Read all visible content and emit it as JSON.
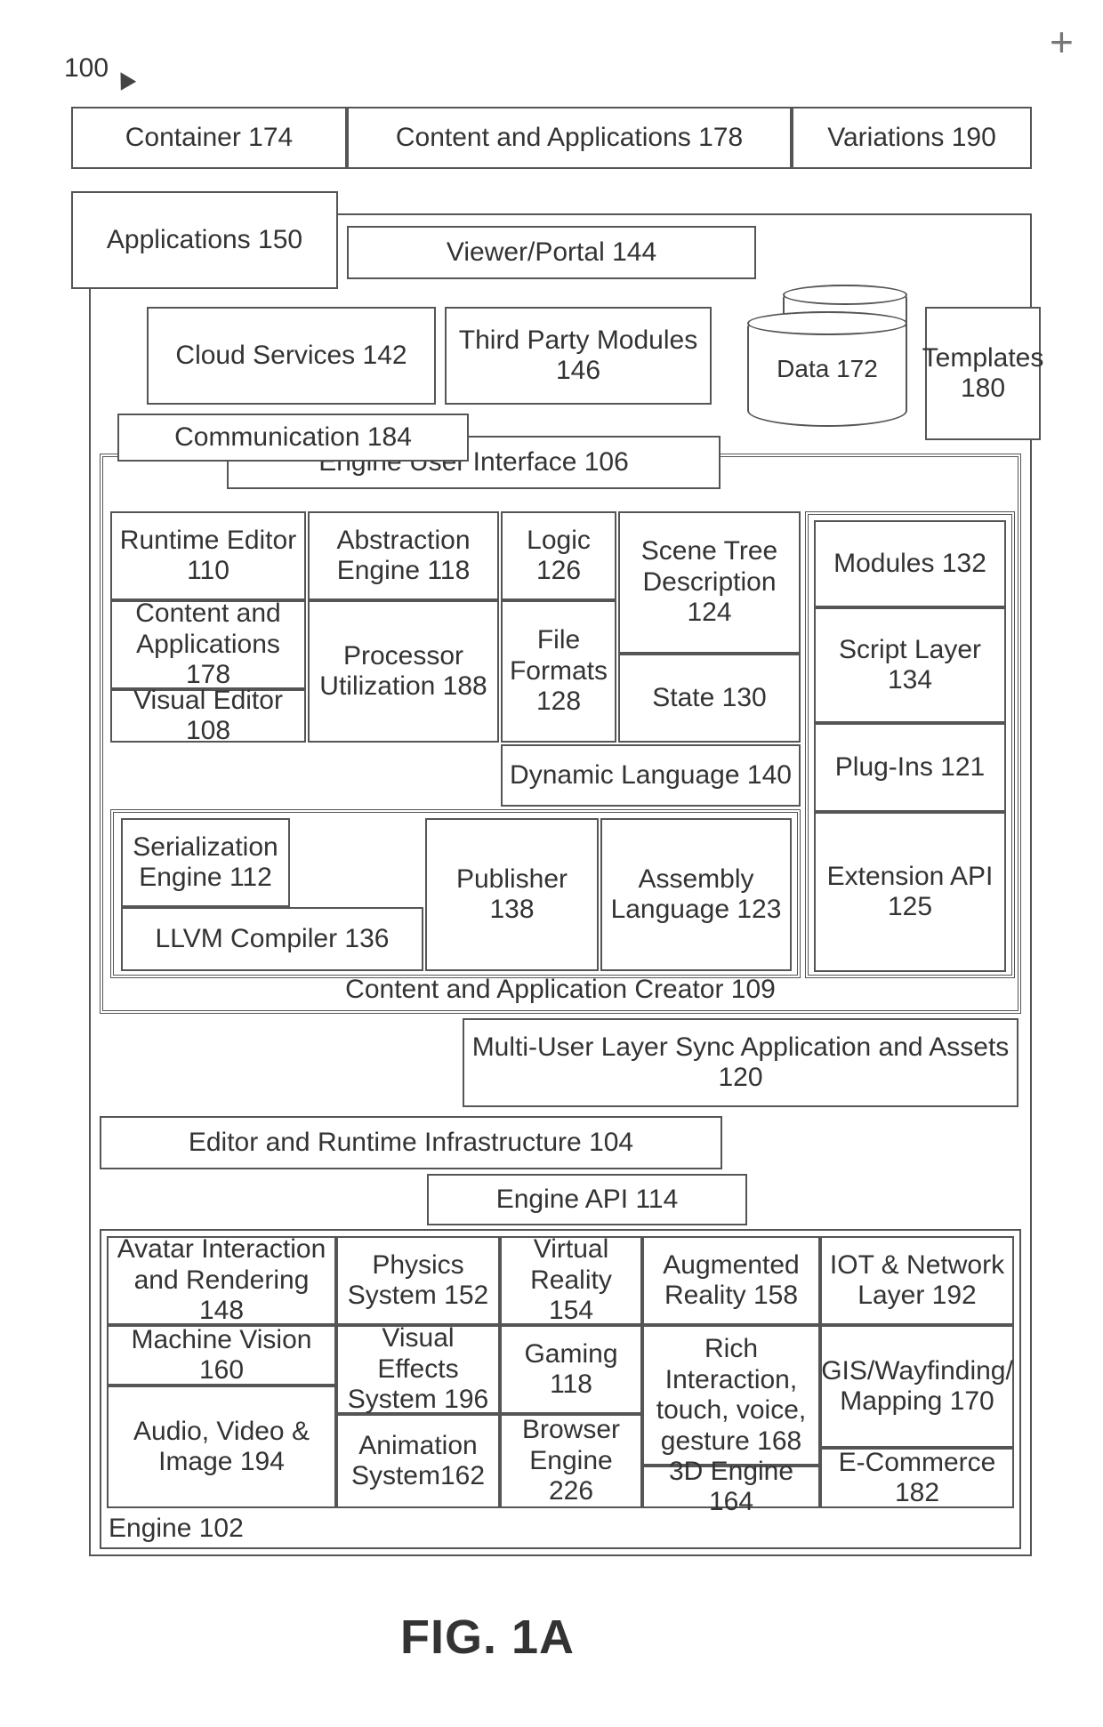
{
  "ref100": "100",
  "figure_label": "FIG. 1A",
  "top": {
    "container": "Container 174",
    "content_apps": "Content and Applications 178",
    "variations": "Variations 190",
    "applications": "Applications 150",
    "cloud": "Cloud Services 142",
    "third_party": "Third Party Modules 146"
  },
  "viewer_portal": "Viewer/Portal 144",
  "engine_ui": "Engine User Interface 106",
  "creator_outer": "Content and Application Creator 109",
  "creator": {
    "runtime_editor": "Runtime Editor 110",
    "content_apps": "Content and Applications 178",
    "visual_editor": "Visual Editor 108",
    "abstraction": "Abstraction Engine 118",
    "proc_util": "Processor Utilization 188",
    "logic": "Logic 126",
    "file_formats": "File Formats 128",
    "scene_tree": "Scene Tree Description 124",
    "state": "State 130",
    "dynamic_lang": "Dynamic Language 140",
    "serialization": "Serialization Engine 112",
    "llvm": "LLVM Compiler 136",
    "publisher": "Publisher 138",
    "assembly": "Assembly Language 123",
    "modules": "Modules 132",
    "script_layer": "Script Layer 134",
    "plugins": "Plug-Ins 121",
    "ext_api": "Extension API 125",
    "multiuser": "Multi-User Layer Sync Application and Assets 120"
  },
  "communication": "Communication 184",
  "editor_runtime_infra": "Editor and Runtime Infrastructure 104",
  "engine_api": "Engine API 114",
  "engine_label": "Engine 102",
  "engine": {
    "avatar": "Avatar Interaction and Rendering 148",
    "machine_vision": "Machine Vision 160",
    "audio_video": "Audio, Video & Image 194",
    "physics": "Physics System 152",
    "visual_effects": "Visual Effects System 196",
    "animation": "Animation System162",
    "vr": "Virtual Reality 154",
    "gaming": "Gaming 118",
    "browser": "Browser Engine 226",
    "ar": "Augmented Reality 158",
    "rich": "Rich Interaction, touch, voice, gesture 168",
    "engine3d": "3D Engine 164",
    "iot": "IOT & Network Layer 192",
    "gis": "GIS/Wayfinding/ Mapping 170",
    "ecommerce": "E-Commerce 182"
  },
  "data_cyl_a": "a",
  "data_cyl": "Data 172",
  "templates": "Templates 180"
}
